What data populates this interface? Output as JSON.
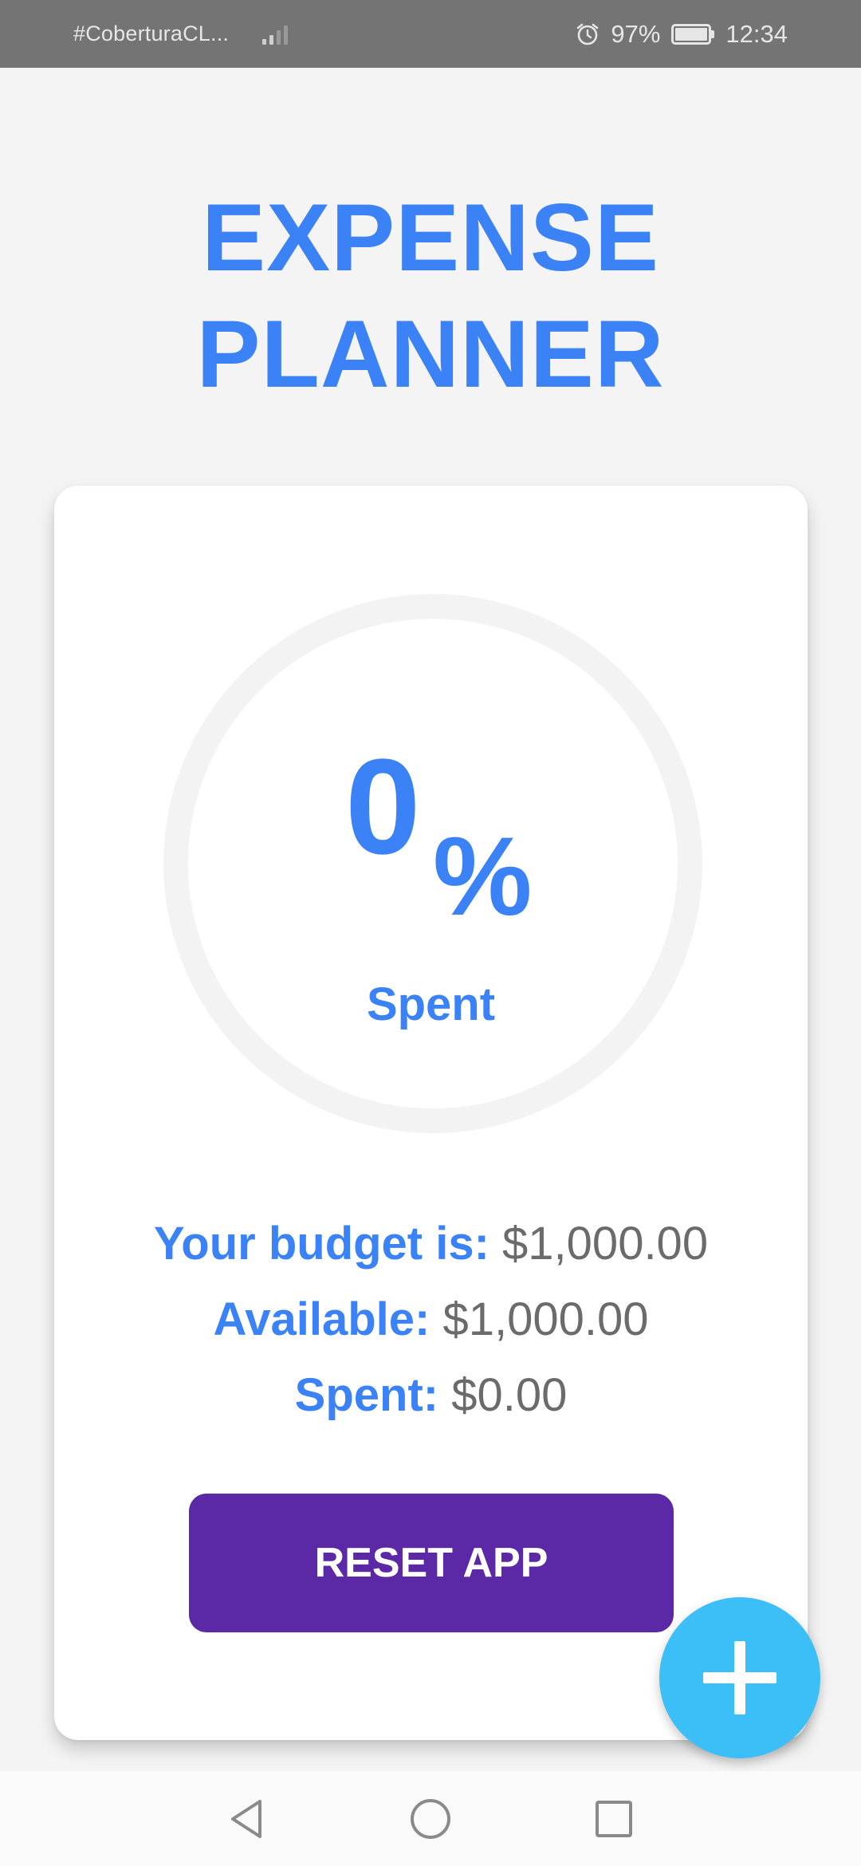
{
  "status_bar": {
    "carrier": "#CoberturaCL...",
    "battery_percent": "97%",
    "time": "12:34",
    "icons": [
      "signal-icon",
      "alarm-icon",
      "battery-icon"
    ]
  },
  "app": {
    "title_line1": "EXPENSE",
    "title_line2": "PLANNER",
    "accent_color": "#3b82f6",
    "button_color": "#5b28a6",
    "fab_color": "#3cbef6"
  },
  "progress": {
    "value": "0",
    "unit": "%",
    "label": "Spent",
    "fraction": 0
  },
  "summary": {
    "budget_label": "Your budget is:",
    "budget_value": "$1,000.00",
    "available_label": "Available:",
    "available_value": "$1,000.00",
    "spent_label": "Spent:",
    "spent_value": "$0.00"
  },
  "actions": {
    "reset_label": "RESET APP",
    "fab_icon": "plus-icon"
  },
  "nav": {
    "icons": [
      "back-icon",
      "home-icon",
      "recents-icon"
    ]
  }
}
